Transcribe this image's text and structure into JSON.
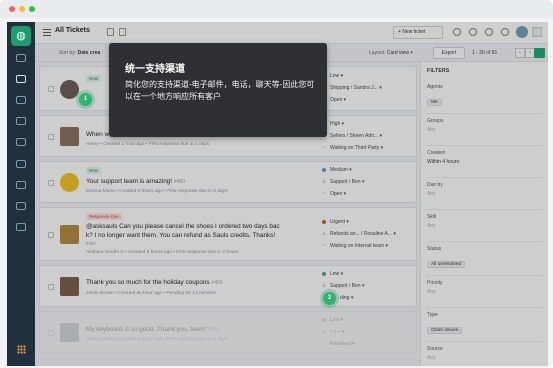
{
  "window": {
    "title": "All Tickets"
  },
  "topbar": {
    "new_ticket_label": "+ New ticket"
  },
  "subbar": {
    "sort_label": "Sort by:",
    "sort_value": "Date crea",
    "layout_label": "Layout:",
    "layout_value": "Card view",
    "export_label": "Export",
    "page_count": "1 - 30 of 81"
  },
  "tickets": [
    {
      "badge": "New",
      "subject": "",
      "meta": "",
      "status": [
        "Low",
        "Shipping / Sandra J...",
        "Open"
      ],
      "priority_color": "#b8bec4"
    },
    {
      "badge": "",
      "subject": "When w",
      "meta": "Henry • Created 1 hour ago • First response due in 2 days",
      "status": [
        "High",
        "Sellers / Sheen Adri...",
        "Waiting on Third Party"
      ],
      "priority_color": "#e04f3c"
    },
    {
      "badge": "New",
      "subject": "Your support team is amazing!",
      "number": "#460",
      "meta": "Monica Maria • Created 2 hours ago • First response due in 6 days",
      "status": [
        "Medium",
        "Support / Ben",
        "Open"
      ],
      "priority_color": "#4aa3df"
    },
    {
      "badge": "Response Due",
      "subject": "@asksauls Can you please cancel the shoes I ordered two days bac",
      "subject2": "k? I no longer want them. You can refund as Sauls credits. Thanks!",
      "number": "#457",
      "meta": "Akshara Srudhi G • Created 5 hours ago • First response due in 2 hours",
      "status": [
        "Urgent",
        "Refunds an... / Rosaline A...",
        "Waiting on Internal team"
      ],
      "priority_color": "#e04f3c"
    },
    {
      "badge": "",
      "subject": "Thank you so much for the holiday coupons",
      "number": "#455",
      "meta": "Jamie Brown • Created an hour ago • Pending for 13 minutes",
      "status": [
        "Low",
        "Support / Ben",
        "ding"
      ],
      "priority_color": "#2fb36e"
    },
    {
      "badge": "",
      "subject": "My keyboard is so good. Thank you, team!",
      "number": "#405",
      "meta": "Sheen Adrian • Created 2 hours ago • First response due in 5 days",
      "status": [
        "Low",
        "-- / --",
        "Resolved"
      ],
      "priority_color": "#b8bec4"
    }
  ],
  "filters": {
    "heading": "FILTERS",
    "groups": [
      {
        "label": "Agents",
        "chip": "Me",
        "value": ""
      },
      {
        "label": "Groups",
        "chip": "",
        "value": "Any"
      },
      {
        "label": "Created",
        "chip": "",
        "value": "Within 4 hours"
      },
      {
        "label": "Due by",
        "chip": "",
        "value": "Any"
      },
      {
        "label": "Skill",
        "chip": "",
        "value": "Any"
      },
      {
        "label": "Status",
        "chip": "All unresolved",
        "value": ""
      },
      {
        "label": "Priority",
        "chip": "",
        "value": "Any"
      },
      {
        "label": "Type",
        "chip": "Order issues",
        "value": ""
      },
      {
        "label": "Source",
        "chip": "",
        "value": "Any"
      }
    ]
  },
  "tooltip": {
    "title": "统一支持渠道",
    "body": "简化您的支持渠道-电子邮件，电话，聊天等-因此您可以在一个地方响应所有客户"
  },
  "steps": {
    "first": "1",
    "second": "2"
  },
  "icons": {
    "nav": [
      "dashboard-icon",
      "tickets-icon",
      "contacts-icon",
      "companies-icon",
      "solutions-icon",
      "forums-icon",
      "reports-icon",
      "admin-icon",
      "settings-icon"
    ],
    "apps_grid": "apps-grid-icon"
  }
}
